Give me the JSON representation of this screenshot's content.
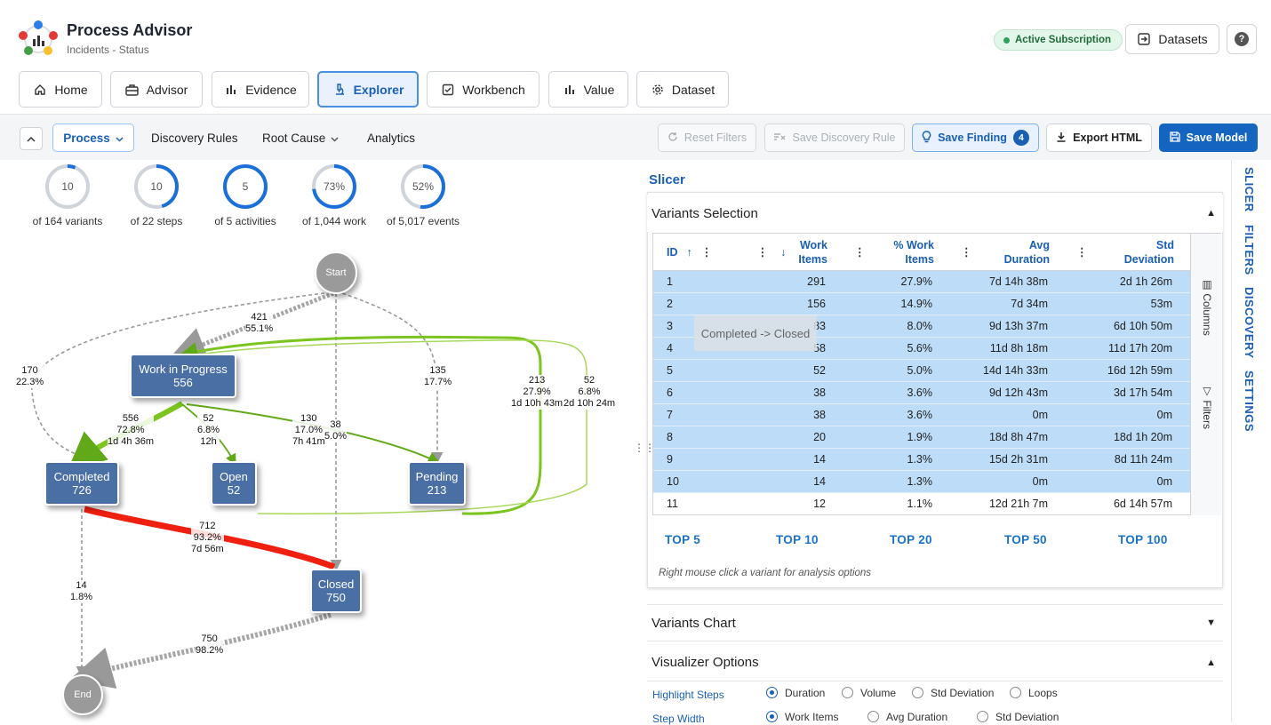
{
  "app": {
    "title": "Process Advisor",
    "subtitle": "Incidents - Status"
  },
  "header": {
    "subscription": "Active Subscription",
    "datasets_label": "Datasets",
    "help": "?"
  },
  "nav": [
    {
      "label": "Home",
      "icon": "home-icon"
    },
    {
      "label": "Advisor",
      "icon": "briefcase-icon"
    },
    {
      "label": "Evidence",
      "icon": "bar-chart-icon"
    },
    {
      "label": "Explorer",
      "icon": "microscope-icon",
      "active": true
    },
    {
      "label": "Workbench",
      "icon": "checkbox-icon"
    },
    {
      "label": "Value",
      "icon": "bar-chart-icon"
    },
    {
      "label": "Dataset",
      "icon": "gear-icon"
    }
  ],
  "toolbar": {
    "tabs": [
      "Process",
      "Discovery Rules",
      "Root Cause",
      "Analytics"
    ],
    "reset_filters": "Reset Filters",
    "save_discovery_rule": "Save Discovery Rule",
    "save_finding": "Save Finding",
    "save_finding_count": "4",
    "export_html": "Export HTML",
    "save_model": "Save Model"
  },
  "stats": [
    {
      "value": "10",
      "label": "of 164 variants",
      "fraction": 0.061
    },
    {
      "value": "10",
      "label": "of 22 steps",
      "fraction": 0.455
    },
    {
      "value": "5",
      "label": "of 5 activities",
      "fraction": 1.0
    },
    {
      "value": "73%",
      "label": "of 1,044 work",
      "fraction": 0.73
    },
    {
      "value": "52%",
      "label": "of 5,017 events",
      "fraction": 0.52
    }
  ],
  "graph": {
    "nodes": {
      "start": "Start",
      "end": "End",
      "wip": {
        "name": "Work in Progress",
        "count": "556"
      },
      "completed": {
        "name": "Completed",
        "count": "726"
      },
      "open": {
        "name": "Open",
        "count": "52"
      },
      "pending": {
        "name": "Pending",
        "count": "213"
      },
      "closed": {
        "name": "Closed",
        "count": "750"
      }
    },
    "edges": {
      "start_wip": [
        "421",
        "55.1%"
      ],
      "start_completed": [
        "170",
        "22.3%"
      ],
      "start_pending": [
        "135",
        "17.7%"
      ],
      "wip_completed": [
        "556",
        "72.8%",
        "1d 4h 36m"
      ],
      "wip_open": [
        "52",
        "6.8%",
        "12h"
      ],
      "wip_pending": [
        "130",
        "17.0%",
        "7h 41m"
      ],
      "start_closed": [
        "38",
        "5.0%"
      ],
      "pending_wip": [
        "213",
        "27.9%",
        "1d 10h 43m"
      ],
      "open_wip": [
        "52",
        "6.8%",
        "2d 10h 24m"
      ],
      "completed_closed": [
        "712",
        "93.2%",
        "7d 56m"
      ],
      "completed_end": [
        "14",
        "1.8%"
      ],
      "closed_end": [
        "750",
        "98.2%"
      ]
    }
  },
  "slicer": {
    "title": "Slicer",
    "variants_selection": "Variants Selection",
    "columns": [
      "ID",
      "Work Items",
      "% Work Items",
      "Avg Duration",
      "Std Deviation"
    ],
    "col_labels": {
      "id": "ID",
      "work1": "Work",
      "work2": "Items",
      "pct1": "% Work",
      "pct2": "Items",
      "avg1": "Avg",
      "avg2": "Duration",
      "std1": "Std",
      "std2": "Deviation"
    },
    "rows": [
      [
        "1",
        "291",
        "27.9%",
        "7d 14h 38m",
        "2d 1h 26m"
      ],
      [
        "2",
        "156",
        "14.9%",
        "7d 34m",
        "53m"
      ],
      [
        "3",
        "83",
        "8.0%",
        "9d 13h 37m",
        "6d 10h 50m"
      ],
      [
        "4",
        "58",
        "5.6%",
        "11d 8h 18m",
        "11d 17h 20m"
      ],
      [
        "5",
        "52",
        "5.0%",
        "14d 14h 33m",
        "16d 12h 59m"
      ],
      [
        "6",
        "38",
        "3.6%",
        "9d 12h 43m",
        "3d 17h 54m"
      ],
      [
        "7",
        "38",
        "3.6%",
        "0m",
        "0m"
      ],
      [
        "8",
        "20",
        "1.9%",
        "18d 8h 47m",
        "18d 1h 20m"
      ],
      [
        "9",
        "14",
        "1.3%",
        "15d 2h 31m",
        "8d 11h 24m"
      ],
      [
        "10",
        "14",
        "1.3%",
        "0m",
        "0m"
      ],
      [
        "11",
        "12",
        "1.1%",
        "12d 21h 7m",
        "6d 14h 57m"
      ]
    ],
    "side_columns": "Columns",
    "side_filters": "Filters",
    "tooltip": "Completed -> Closed",
    "top_links": [
      "TOP 5",
      "TOP 10",
      "TOP 20",
      "TOP 50",
      "TOP 100"
    ],
    "hint": "Right mouse click a variant for analysis options",
    "variants_chart": "Variants Chart",
    "visualizer_options": "Visualizer Options",
    "highlight_steps": {
      "label": "Highlight Steps",
      "options": [
        "Duration",
        "Volume",
        "Std Deviation",
        "Loops"
      ],
      "selected": "Duration"
    },
    "step_width": {
      "label": "Step Width",
      "options": [
        "Work Items",
        "Avg Duration",
        "Std Deviation"
      ],
      "selected": "Work Items"
    }
  },
  "vtabs": [
    "SLICER",
    "FILTERS",
    "DISCOVERY",
    "SETTINGS"
  ],
  "colors": {
    "accent": "#1a5fb4",
    "node": "#4a6fa5",
    "row_selected": "#bcdcf7",
    "hot_edge": "#f02010",
    "green_edge": "#7cc520"
  }
}
